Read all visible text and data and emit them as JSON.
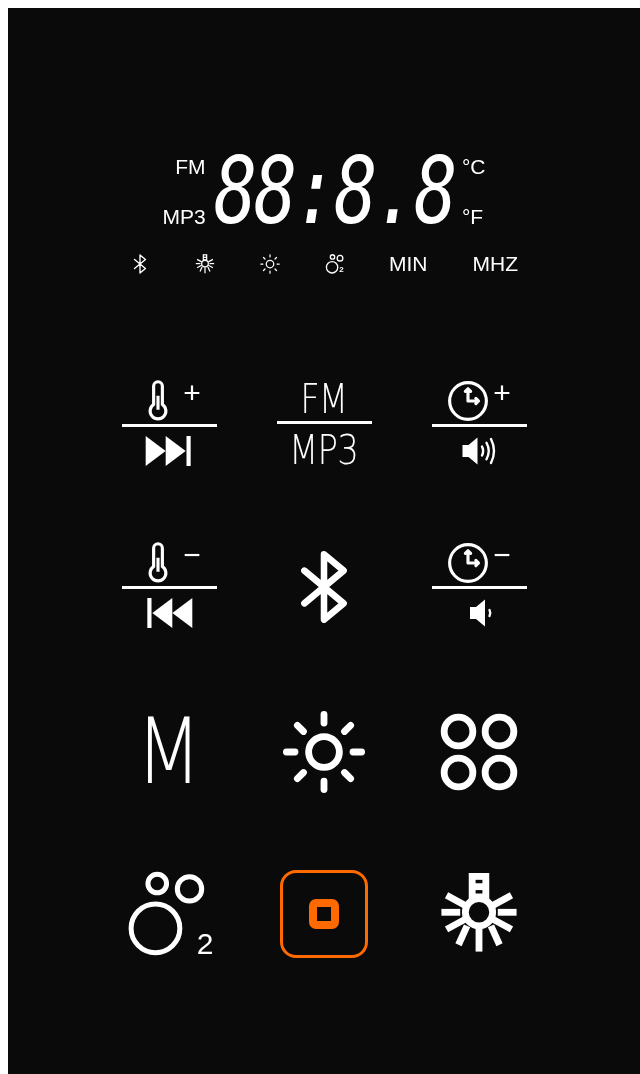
{
  "display": {
    "left_labels": [
      "FM",
      "MP3"
    ],
    "digits": "88:8.8",
    "units": [
      "°C",
      "°F"
    ],
    "indicators": [
      {
        "kind": "bluetooth"
      },
      {
        "kind": "lamp"
      },
      {
        "kind": "sun"
      },
      {
        "kind": "oxygen",
        "sub": "2"
      },
      {
        "kind": "label",
        "text": "MIN"
      },
      {
        "kind": "label",
        "text": "MHZ"
      }
    ]
  },
  "buttons": [
    {
      "kind": "tempup",
      "sign": "+"
    },
    {
      "kind": "mode",
      "top": "FM",
      "bottom": "MP3"
    },
    {
      "kind": "timeup",
      "sign": "+"
    },
    {
      "kind": "tempdown",
      "sign": "−"
    },
    {
      "kind": "bluetooth"
    },
    {
      "kind": "timedown",
      "sign": "−"
    },
    {
      "kind": "memory",
      "text": "M"
    },
    {
      "kind": "sun"
    },
    {
      "kind": "circles"
    },
    {
      "kind": "oxygen",
      "sub": "2"
    },
    {
      "kind": "power",
      "active": true
    },
    {
      "kind": "lamp"
    }
  ]
}
